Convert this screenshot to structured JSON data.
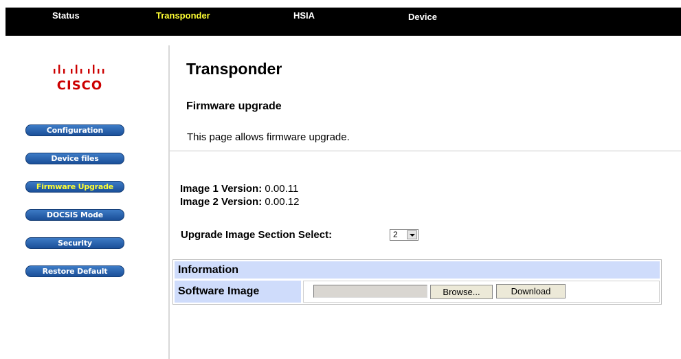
{
  "nav": {
    "items": [
      {
        "label": "Status"
      },
      {
        "label": "Transponder"
      },
      {
        "label": "HSIA"
      },
      {
        "label": "Device"
      }
    ]
  },
  "sidebar": {
    "logo_text": "CISCO",
    "items": [
      {
        "label": "Configuration"
      },
      {
        "label": "Device files"
      },
      {
        "label": "Firmware Upgrade"
      },
      {
        "label": "DOCSIS Mode"
      },
      {
        "label": "Security"
      },
      {
        "label": "Restore Default"
      }
    ]
  },
  "main": {
    "title": "Transponder",
    "subtitle": "Firmware upgrade",
    "description": "This page allows firmware upgrade.",
    "image1": {
      "label": "Image 1 Version:",
      "value": "0.00.11"
    },
    "image2": {
      "label": "Image 2 Version:",
      "value": "0.00.12"
    },
    "select": {
      "label": "Upgrade Image Section Select:",
      "value": "2"
    },
    "table": {
      "header": "Information",
      "row_label": "Software Image",
      "browse_label": "Browse...",
      "download_label": "Download"
    }
  },
  "colors": {
    "topbar_bg": "#000000",
    "active_nav": "#ffff33",
    "sidebar_button": "#2a64b4",
    "logo_red": "#cc0000",
    "table_header_bg": "#cfdcfb"
  }
}
